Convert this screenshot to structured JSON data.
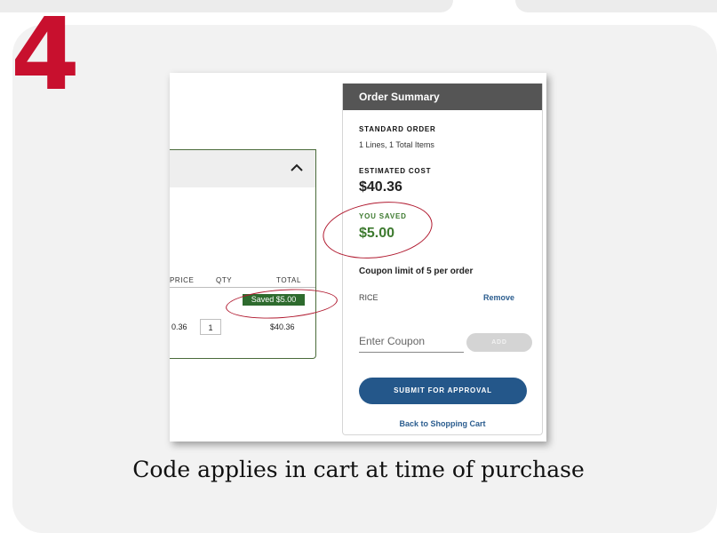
{
  "step": {
    "number": "4"
  },
  "cart": {
    "columns": [
      "PRICE",
      "QTY",
      "TOTAL"
    ],
    "saved_badge": "Saved $5.00",
    "row": {
      "price": "0.36",
      "qty": "1",
      "total": "$40.36"
    }
  },
  "order_summary": {
    "title": "Order Summary",
    "standard_order_label": "STANDARD ORDER",
    "lines_text": "1 Lines, 1 Total Items",
    "estimated_cost_label": "ESTIMATED COST",
    "estimated_cost": "$40.36",
    "you_saved_label": "YOU SAVED",
    "you_saved": "$5.00",
    "coupon_limit": "Coupon limit of 5 per order",
    "coupon_code": "RICE",
    "remove_label": "Remove",
    "coupon_placeholder": "Enter Coupon",
    "add_label": "ADD",
    "submit_label": "SUBMIT FOR APPROVAL",
    "back_label": "Back to Shopping Cart"
  },
  "caption": "Code applies in cart at time of purchase",
  "colors": {
    "step_red": "#c8102e",
    "header_gray": "#555555",
    "saved_green": "#3d7a2f",
    "button_blue": "#24578a",
    "highlight_circle": "#b0182e"
  }
}
